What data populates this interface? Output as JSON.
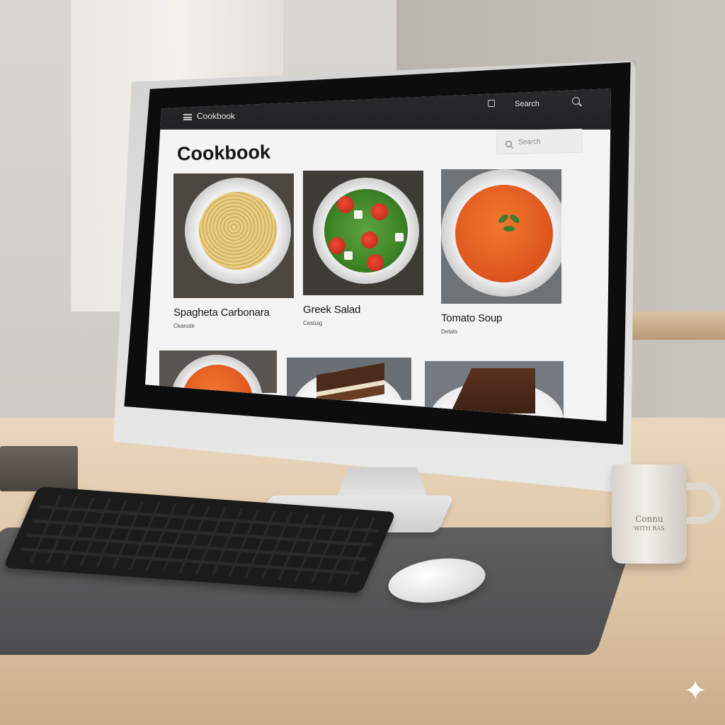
{
  "app": {
    "window_title": "Cookbook",
    "topbar_search_label": "Search",
    "page_title": "Cookbook",
    "search_placeholder": "Search"
  },
  "recipes": [
    {
      "title": "Spagheta Carbonara",
      "subtitle": "Ckanotir"
    },
    {
      "title": "Greek Salad",
      "subtitle": "Cestuig"
    },
    {
      "title": "Tomato Soup",
      "subtitle": "Detats"
    }
  ],
  "mug": {
    "line1": "Connu",
    "line2": "WITH RAS"
  },
  "icons": {
    "menu": "hamburger-icon",
    "calendar": "calendar-icon",
    "search": "search-icon",
    "corner": "sparkle-icon"
  },
  "colors": {
    "app_bar": "#222224",
    "screen_bg": "#f4f4f4",
    "title_text": "#161616"
  }
}
